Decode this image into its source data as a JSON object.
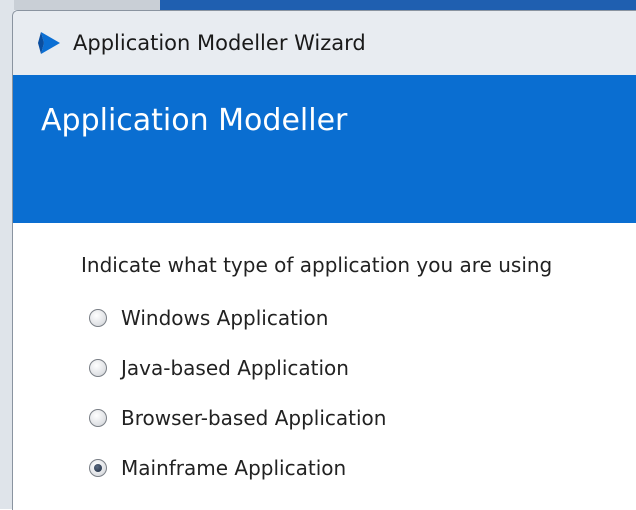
{
  "window": {
    "title": "Application Modeller Wizard",
    "icon": "blue-prism-logo-icon"
  },
  "banner": {
    "title": "Application Modeller"
  },
  "form": {
    "question": "Indicate what type of application you are using",
    "options": [
      {
        "label": "Windows Application",
        "selected": false
      },
      {
        "label": "Java-based Application",
        "selected": false
      },
      {
        "label": "Browser-based Application",
        "selected": false
      },
      {
        "label": "Mainframe Application",
        "selected": true
      }
    ]
  },
  "colors": {
    "banner": "#0a6ed1",
    "titlebar": "#e8ecf1",
    "text": "#222222"
  }
}
